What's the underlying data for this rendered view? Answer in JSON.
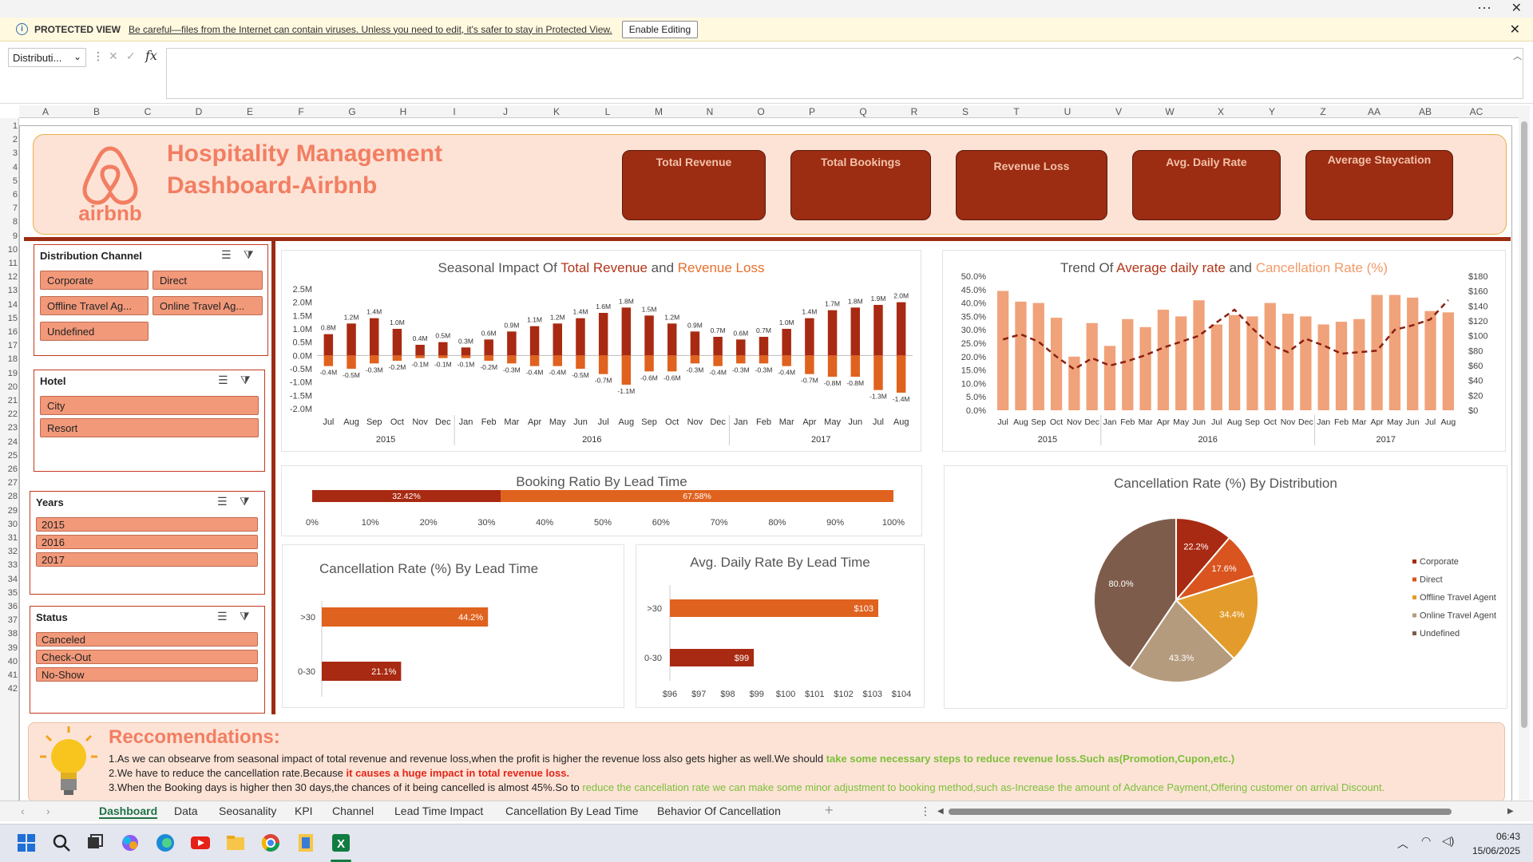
{
  "window": {
    "more": "···",
    "close": "✕"
  },
  "protected": {
    "label": "PROTECTED VIEW",
    "message": "Be careful—files from the Internet can contain viruses. Unless you need to edit, it's safer to stay in Protected View.",
    "button": "Enable Editing",
    "close": "✕"
  },
  "formula": {
    "namebox": "Distributi...",
    "fx": "fx"
  },
  "columns": [
    "A",
    "B",
    "C",
    "D",
    "E",
    "F",
    "G",
    "H",
    "I",
    "J",
    "K",
    "L",
    "M",
    "N",
    "O",
    "P",
    "Q",
    "R",
    "S",
    "T",
    "U",
    "V",
    "W",
    "X",
    "Y",
    "Z",
    "AA",
    "AB",
    "AC"
  ],
  "rows": [
    "1",
    "2",
    "3",
    "4",
    "5",
    "6",
    "7",
    "8",
    "9",
    "10",
    "11",
    "12",
    "13",
    "14",
    "15",
    "16",
    "17",
    "18",
    "19",
    "20",
    "21",
    "22",
    "23",
    "24",
    "25",
    "26",
    "27",
    "28",
    "29",
    "30",
    "31",
    "32",
    "33",
    "34",
    "35",
    "36",
    "37",
    "38",
    "39",
    "40",
    "41",
    "42"
  ],
  "header": {
    "logo_text": "airbnb",
    "title_line1": "Hospitality Management",
    "title_line2": "Dashboard-Airbnb",
    "kpis": [
      "Total Revenue",
      "Total Bookings",
      "Revenue Loss",
      "Avg. Daily Rate",
      "Average Staycation"
    ]
  },
  "slicers": {
    "distribution": {
      "title": "Distribution Channel",
      "items": [
        "Corporate",
        "Direct",
        "Offline Travel Ag...",
        "Online Travel Ag...",
        "Undefined"
      ]
    },
    "hotel": {
      "title": "Hotel",
      "items": [
        "City",
        "Resort"
      ]
    },
    "years": {
      "title": "Years",
      "items": [
        "2015",
        "2016",
        "2017"
      ]
    },
    "status": {
      "title": "Status",
      "items": [
        "Canceled",
        "Check-Out",
        "No-Show"
      ]
    }
  },
  "chart_data": [
    {
      "id": "seasonal",
      "type": "bar",
      "title_parts": [
        "Seasonal Impact Of ",
        "Total Revenue",
        " and ",
        "Revenue Loss"
      ],
      "categories": [
        "Jul",
        "Aug",
        "Sep",
        "Oct",
        "Nov",
        "Dec",
        "Jan",
        "Feb",
        "Mar",
        "Apr",
        "May",
        "Jun",
        "Jul",
        "Aug",
        "Sep",
        "Oct",
        "Nov",
        "Dec",
        "Jan",
        "Feb",
        "Mar",
        "Apr",
        "May",
        "Jun",
        "Jul",
        "Aug"
      ],
      "years": [
        {
          "label": "2015",
          "from": 0,
          "to": 5
        },
        {
          "label": "2016",
          "from": 6,
          "to": 17
        },
        {
          "label": "2017",
          "from": 18,
          "to": 25
        }
      ],
      "series": [
        {
          "values": [
            0.8,
            1.2,
            1.4,
            1.0,
            0.4,
            0.5,
            0.3,
            0.6,
            0.9,
            1.1,
            1.2,
            1.4,
            1.6,
            1.8,
            1.5,
            1.2,
            0.9,
            0.7,
            0.6,
            0.7,
            1.0,
            1.4,
            1.7,
            1.8,
            1.9,
            2.0
          ],
          "labels": [
            "0.8M",
            "1.2M",
            "1.4M",
            "1.0M",
            "0.4M",
            "0.5M",
            "0.3M",
            "0.6M",
            "0.9M",
            "1.1M",
            "1.2M",
            "1.4M",
            "1.6M",
            "1.8M",
            "1.5M",
            "1.2M",
            "0.9M",
            "0.7M",
            "0.6M",
            "0.7M",
            "1.0M",
            "1.4M",
            "1.7M",
            "1.8M",
            "1.9M",
            "2.0M"
          ],
          "color": "#a82a12"
        },
        {
          "values": [
            -0.4,
            -0.5,
            -0.3,
            -0.2,
            -0.1,
            -0.1,
            -0.1,
            -0.2,
            -0.3,
            -0.4,
            -0.4,
            -0.5,
            -0.7,
            -1.1,
            -0.6,
            -0.6,
            -0.3,
            -0.4,
            -0.3,
            -0.3,
            -0.4,
            -0.7,
            -0.8,
            -0.8,
            -1.3,
            -1.4
          ],
          "labels": [
            "-0.4M",
            "-0.5M",
            "-0.3M",
            "-0.2M",
            "-0.1M",
            "-0.1M",
            "-0.1M",
            "-0.2M",
            "-0.3M",
            "-0.4M",
            "-0.4M",
            "-0.5M",
            "-0.7M",
            "-1.1M",
            "-0.6M",
            "-0.6M",
            "-0.3M",
            "-0.4M",
            "-0.3M",
            "-0.3M",
            "-0.4M",
            "-0.7M",
            "-0.8M",
            "-0.8M",
            "-1.3M",
            "-1.4M"
          ],
          "color": "#e0621f"
        }
      ],
      "yticks": [
        "2.5M",
        "2.0M",
        "1.5M",
        "1.0M",
        "0.5M",
        "0.0M",
        "-0.5M",
        "-1.0M",
        "-1.5M",
        "-2.0M"
      ],
      "ylim": [
        -2.0,
        2.5
      ]
    },
    {
      "id": "trend",
      "type": "bar+line",
      "title_parts": [
        "Trend Of ",
        "Average daily rate",
        " and ",
        "Cancellation Rate (%)"
      ],
      "categories": [
        "Jul",
        "Aug",
        "Sep",
        "Oct",
        "Nov",
        "Dec",
        "Jan",
        "Feb",
        "Mar",
        "Apr",
        "May",
        "Jun",
        "Jul",
        "Aug",
        "Sep",
        "Oct",
        "Nov",
        "Dec",
        "Jan",
        "Feb",
        "Mar",
        "Apr",
        "May",
        "Jun",
        "Jul",
        "Aug"
      ],
      "years": [
        {
          "label": "2015",
          "from": 0,
          "to": 5
        },
        {
          "label": "2016",
          "from": 6,
          "to": 17
        },
        {
          "label": "2017",
          "from": 18,
          "to": 25
        }
      ],
      "bars": [
        44.5,
        40.5,
        40,
        34.5,
        20,
        32.5,
        24,
        34,
        31,
        37.5,
        35,
        41,
        32,
        35.5,
        35,
        40,
        36,
        35,
        32,
        33,
        34,
        43,
        43,
        42,
        37,
        36.5
      ],
      "line": [
        95,
        102,
        92,
        72,
        55,
        70,
        60,
        66,
        74,
        84,
        92,
        100,
        118,
        135,
        110,
        88,
        78,
        96,
        87,
        76,
        78,
        80,
        108,
        114,
        122,
        148
      ],
      "yticks_left": [
        "50.0%",
        "45.0%",
        "40.0%",
        "35.0%",
        "30.0%",
        "25.0%",
        "20.0%",
        "15.0%",
        "10.0%",
        "5.0%",
        "0.0%"
      ],
      "yticks_right": [
        "$180",
        "$160",
        "$140",
        "$120",
        "$100",
        "$80",
        "$60",
        "$40",
        "$20",
        "$0"
      ],
      "ylim_left": [
        0,
        50
      ],
      "ylim_right": [
        0,
        180
      ]
    },
    {
      "id": "booking_ratio",
      "type": "bar",
      "title": "Booking Ratio By Lead Time",
      "values": [
        32.42,
        67.58
      ],
      "labels": [
        "32.42%",
        "67.58%"
      ],
      "colors": [
        "#a82a12",
        "#e0621f"
      ],
      "xticks": [
        "0%",
        "10%",
        "20%",
        "30%",
        "40%",
        "50%",
        "60%",
        "70%",
        "80%",
        "90%",
        "100%"
      ]
    },
    {
      "id": "cancel_lead",
      "type": "bar",
      "title": "Cancellation Rate (%) By Lead Time",
      "categories": [
        ">30",
        "0-30"
      ],
      "values": [
        44.2,
        21.1
      ],
      "labels": [
        "44.2%",
        "21.1%"
      ],
      "colors": [
        "#e0621f",
        "#a82a12"
      ],
      "xlim": [
        0,
        100
      ]
    },
    {
      "id": "adr_lead",
      "type": "bar",
      "title": "Avg. Daily Rate By Lead Time",
      "categories": [
        ">30",
        "0-30"
      ],
      "values": [
        103.2,
        98.9
      ],
      "labels": [
        "$103",
        "$99"
      ],
      "colors": [
        "#e0621f",
        "#a82a12"
      ],
      "xticks": [
        "$96",
        "$97",
        "$98",
        "$99",
        "$100",
        "$101",
        "$102",
        "$103",
        "$104"
      ],
      "xlim": [
        96,
        104
      ]
    },
    {
      "id": "cancel_dist",
      "type": "pie",
      "title": "Cancellation Rate (%) By Distribution",
      "slices": [
        {
          "name": "Corporate",
          "value": 22.2,
          "label": "22.2%",
          "color": "#a82a12"
        },
        {
          "name": "Direct",
          "value": 17.6,
          "label": "17.6%",
          "color": "#d9541f"
        },
        {
          "name": "Offline Travel Agent",
          "value": 34.4,
          "label": "34.4%",
          "color": "#e39c2c"
        },
        {
          "name": "Online Travel Agent",
          "value": 43.3,
          "label": "43.3%",
          "color": "#b59b7e"
        },
        {
          "name": "Undefined",
          "value": 80.0,
          "label": "80.0%",
          "color": "#7e5c4c"
        }
      ]
    }
  ],
  "reco": {
    "title": "Reccomendations:",
    "l1a": "1.As we can obsearve from seasonal impact of total revenue and revenue loss,when the profit is higher the revenue loss also gets higher as well.We should ",
    "l1b": "take some necessary steps to reduce revenue loss.Such as(Promotion,Cupon,etc.)",
    "l2a": "2.We have to reduce the cancellation rate.Because ",
    "l2b": "it causes a huge impact in total revenue loss.",
    "l3a": "3.When the Booking days is higher then 30 days,the chances of it being cancelled is almost 45%.So to ",
    "l3b": "reduce the cancellation rate we can make some minor adjustment to booking method,such as-Increase the amount of Advance Payment,Offering customer on arrival Discount."
  },
  "tabs": [
    "Dashboard",
    "Data",
    "Seosanality",
    "KPI",
    "Channel",
    "Lead Time Impact",
    "Cancellation By Lead Time",
    "Behavior Of Cancellation"
  ],
  "tabs_add": "+",
  "clock": {
    "time": "06:43",
    "date": "15/06/2025"
  },
  "colors": {
    "brand": "#f27e62",
    "kpi": "#9c2c12",
    "accent": "#e0621f"
  }
}
